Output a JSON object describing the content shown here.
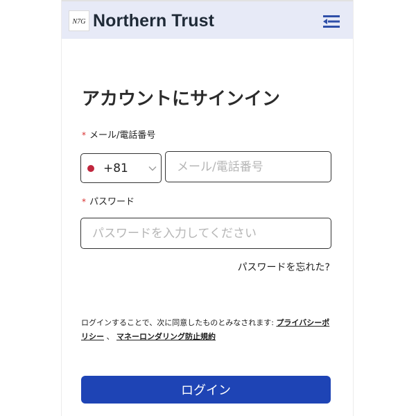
{
  "header": {
    "logo_text": "N7G",
    "brand_name": "Northern Trust",
    "menu_icon": "menu-collapse-icon"
  },
  "signin": {
    "title": "アカウントにサインイン",
    "required_mark": "*",
    "email_label": "メール/電話番号",
    "country_code": "+81",
    "country_flag_icon": "japan-flag-icon",
    "email_placeholder": "メール/電話番号",
    "password_label": "パスワード",
    "password_placeholder": "パスワードを入力してください",
    "forgot_password": "パスワードを忘れた?",
    "terms_prefix": "ログインすることで、次に同意したものとみなされます:",
    "privacy_policy": "プライバシーポリシー",
    "separator": "、",
    "aml_policy": "マネーロンダリング防止規約",
    "login_button": "ログイン"
  },
  "colors": {
    "header_bg": "#e7eaf7",
    "accent": "#1e44b5",
    "required": "#d8302f",
    "flag": "#c0263d"
  }
}
